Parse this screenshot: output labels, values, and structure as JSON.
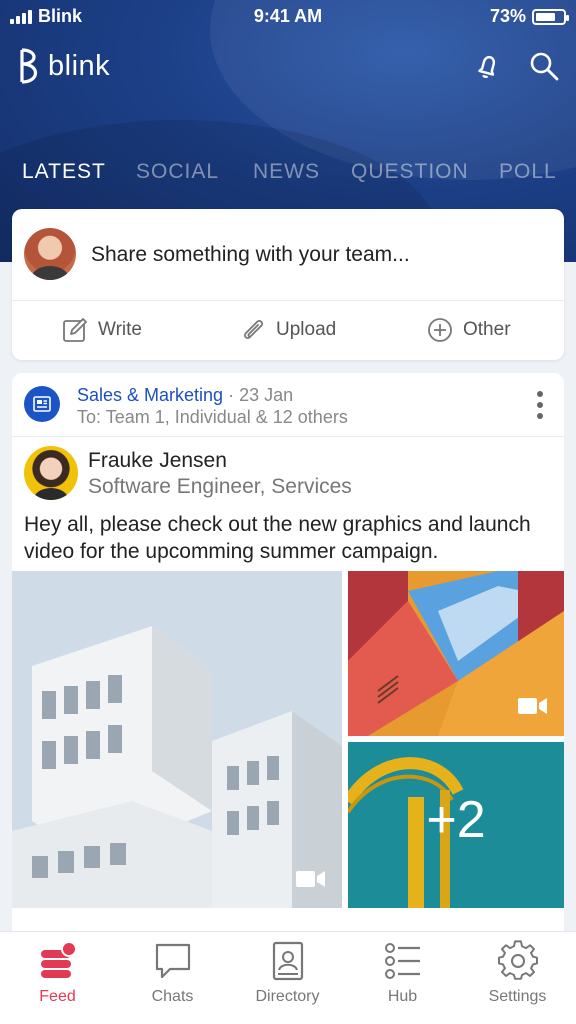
{
  "status_bar": {
    "carrier": "Blink",
    "time": "9:41 AM",
    "battery": "73%",
    "battery_level": 0.73
  },
  "brand": {
    "name": "blink"
  },
  "tabs": [
    {
      "label": "LATEST",
      "active": true
    },
    {
      "label": "SOCIAL",
      "active": false
    },
    {
      "label": "NEWS",
      "active": false
    },
    {
      "label": "QUESTION",
      "active": false
    },
    {
      "label": "POLL",
      "active": false
    }
  ],
  "composer": {
    "placeholder": "Share something with your team...",
    "actions": [
      {
        "label": "Write",
        "icon": "edit-icon"
      },
      {
        "label": "Upload",
        "icon": "paperclip-icon"
      },
      {
        "label": "Other",
        "icon": "plus-circle-icon"
      }
    ]
  },
  "post": {
    "group": "Sales & Marketing",
    "date": "· 23 Jan",
    "to": "To: Team 1, Individual & 12 others",
    "author_name": "Frauke Jensen",
    "author_role": "Software Engineer, Services",
    "text": "Hey all, please check out the new graphics and launch video for the upcomming summer campaign.",
    "more_media": "+2"
  },
  "nav": [
    {
      "label": "Feed",
      "icon": "feed-icon",
      "active": true
    },
    {
      "label": "Chats",
      "icon": "chat-icon",
      "active": false
    },
    {
      "label": "Directory",
      "icon": "directory-icon",
      "active": false
    },
    {
      "label": "Hub",
      "icon": "hub-icon",
      "active": false
    },
    {
      "label": "Settings",
      "icon": "gear-icon",
      "active": false
    }
  ],
  "colors": {
    "brand_blue": "#1c3f86",
    "link_blue": "#1d4fc0",
    "accent_red": "#e23a55"
  }
}
